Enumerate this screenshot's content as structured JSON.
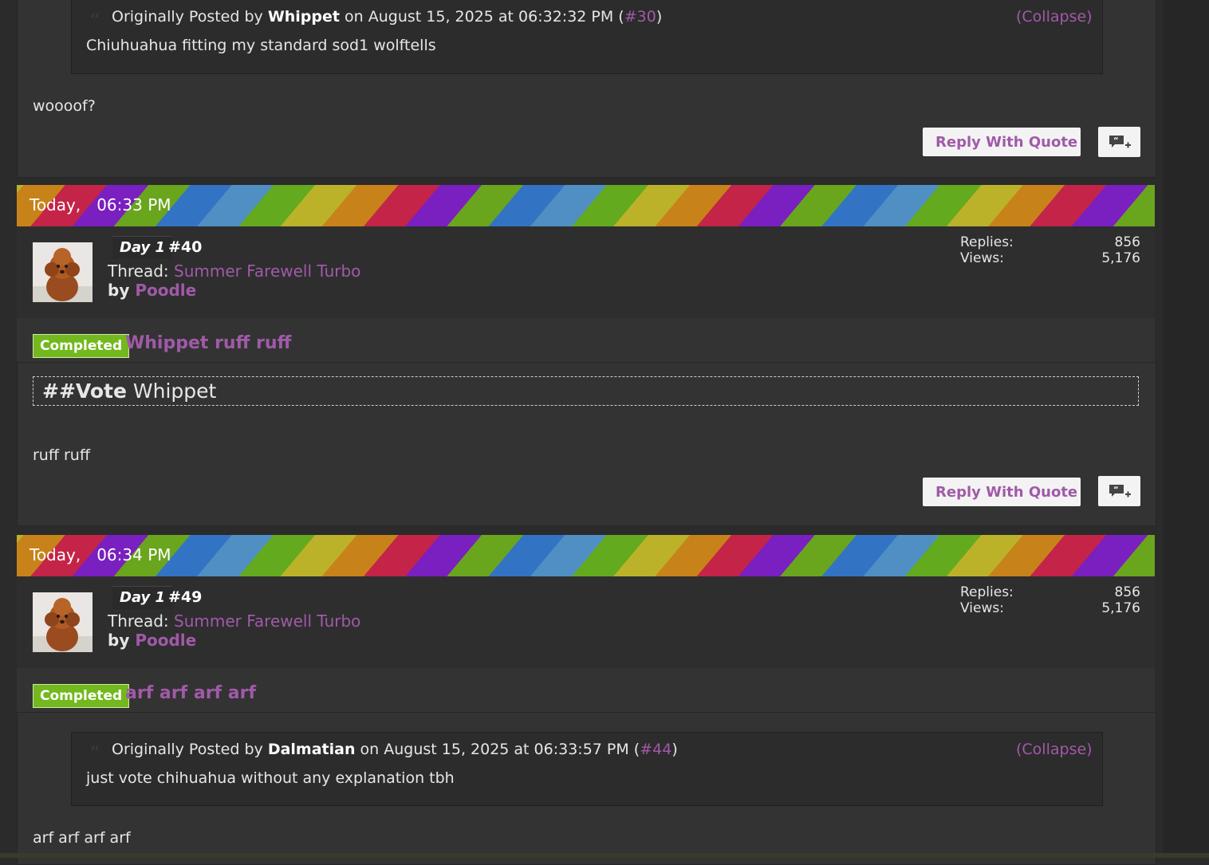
{
  "posts": {
    "p30_tail": {
      "quote": {
        "prefix": "Originally Posted by",
        "author": "Whippet",
        "on": "on August 15, 2025 at 06:32:32 PM (",
        "ref": "#30",
        "close": ")",
        "collapse": "(Collapse)",
        "text": "Chiuhuahua fitting my standard sod1 wolftells"
      },
      "message": "woooof?",
      "reply_with_quote": "Reply With Quote"
    },
    "p40": {
      "date": "Today,",
      "time": "06:33 PM",
      "day": "Day 1",
      "number": "#40",
      "thread_label": "Thread:",
      "thread": "Summer Farewell Turbo",
      "by": "by",
      "author": "Poodle",
      "replies_label": "Replies:",
      "replies": "856",
      "views_label": "Views:",
      "views": "5,176",
      "status": "Completed",
      "title": "Whippet ruff ruff",
      "vote_prefix": "##Vote",
      "vote_target": "Whippet",
      "message": "ruff ruff",
      "reply_with_quote": "Reply With Quote"
    },
    "p49": {
      "date": "Today,",
      "time": "06:34 PM",
      "day": "Day 1",
      "number": "#49",
      "thread_label": "Thread:",
      "thread": "Summer Farewell Turbo",
      "by": "by",
      "author": "Poodle",
      "replies_label": "Replies:",
      "replies": "856",
      "views_label": "Views:",
      "views": "5,176",
      "status": "Completed",
      "title": "arf arf arf arf",
      "quote": {
        "prefix": "Originally Posted by",
        "author": "Dalmatian",
        "on": "on August 15, 2025 at 06:33:57 PM (",
        "ref": "#44",
        "close": ")",
        "collapse": "(Collapse)",
        "text": "just vote chihuahua without any explanation tbh"
      },
      "message": "arf arf arf arf"
    }
  },
  "icons": {
    "quote": "quote-icon",
    "reply": "reply-quote-icon",
    "multiquote": "multiquote-plus-icon"
  }
}
